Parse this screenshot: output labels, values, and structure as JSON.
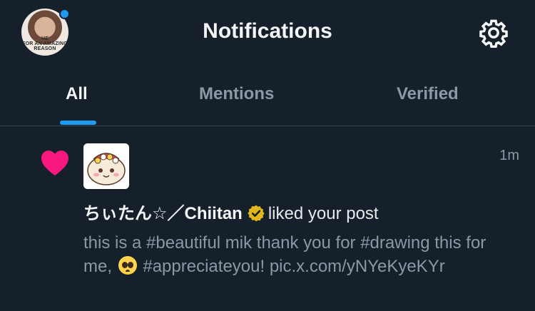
{
  "header": {
    "title": "Notifications",
    "avatar_text": "HE\nFOR AN AMAZING\nREASON",
    "icons": {
      "avatar": "profile-avatar",
      "settings": "gear-icon"
    }
  },
  "tabs": [
    {
      "label": "All",
      "active": true
    },
    {
      "label": "Mentions",
      "active": false
    },
    {
      "label": "Verified",
      "active": false
    }
  ],
  "notification": {
    "type_icon": "heart-icon",
    "time": "1m",
    "author": "ちぃたん☆／Chiitan",
    "action": "liked your post",
    "post_before_emoji": "this is a #beautiful mik thank you for #drawing this for me,",
    "emoji": "pleading-face-emoji",
    "post_after_emoji": "#appreciateyou! pic.x.com/yNYeKyeKYr"
  },
  "colors": {
    "background": "#15202b",
    "accent": "#1d9bf0",
    "heart": "#f91880",
    "verified_badge": "#e2b719",
    "muted_text": "#8b98a5",
    "divider": "#38444d"
  }
}
